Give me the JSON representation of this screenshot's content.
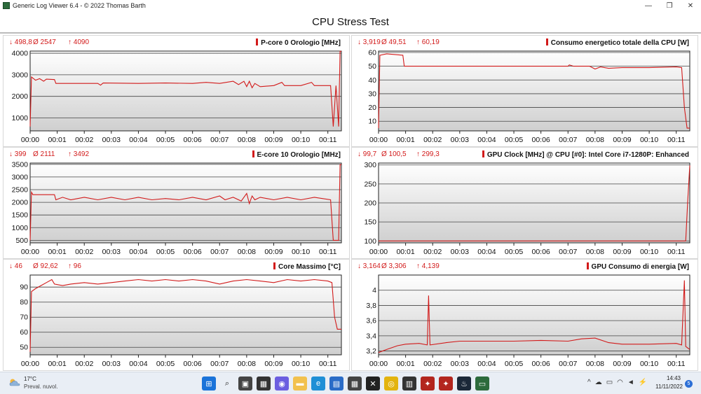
{
  "window": {
    "title": "Generic Log Viewer 6.4 - © 2022 Thomas Barth",
    "minimize_glyph": "—",
    "restore_glyph": "❐",
    "close_glyph": "✕"
  },
  "page_title": "CPU Stress Test",
  "colors": {
    "series": "#d21a1a",
    "grid": "#444444",
    "fill_top": "#ffffff",
    "fill_bottom": "#cfcfcf"
  },
  "panels": [
    {
      "title": "P-core 0 Orologio [MHz]",
      "min": "↓ 498,8",
      "avg": "Ø 2547",
      "max": "↑ 4090",
      "chart_data": {
        "type": "line",
        "ylim": [
          400,
          4100
        ],
        "y_ticks": [
          "4000",
          "3000",
          "2000",
          "1000"
        ],
        "y_tick_values": [
          4000,
          3000,
          2000,
          1000
        ],
        "x_ticks": [
          "00:00",
          "00:01",
          "00:02",
          "00:03",
          "00:04",
          "00:05",
          "00:06",
          "00:07",
          "00:08",
          "00:09",
          "00:10",
          "00:11"
        ],
        "duration_min": 11.5,
        "points": [
          [
            0,
            600
          ],
          [
            0.05,
            2900
          ],
          [
            0.2,
            2750
          ],
          [
            0.35,
            2820
          ],
          [
            0.5,
            2700
          ],
          [
            0.6,
            2800
          ],
          [
            0.9,
            2780
          ],
          [
            0.95,
            2600
          ],
          [
            2.5,
            2600
          ],
          [
            2.6,
            2520
          ],
          [
            2.7,
            2620
          ],
          [
            4,
            2600
          ],
          [
            5,
            2620
          ],
          [
            6,
            2600
          ],
          [
            6.5,
            2650
          ],
          [
            7,
            2600
          ],
          [
            7.5,
            2700
          ],
          [
            7.7,
            2550
          ],
          [
            7.9,
            2700
          ],
          [
            8,
            2450
          ],
          [
            8.1,
            2700
          ],
          [
            8.2,
            2400
          ],
          [
            8.3,
            2600
          ],
          [
            8.5,
            2450
          ],
          [
            9,
            2500
          ],
          [
            9.3,
            2650
          ],
          [
            9.4,
            2500
          ],
          [
            10,
            2500
          ],
          [
            10.4,
            2650
          ],
          [
            10.5,
            2500
          ],
          [
            11.1,
            2500
          ],
          [
            11.2,
            600
          ],
          [
            11.3,
            2500
          ],
          [
            11.4,
            600
          ],
          [
            11.45,
            4090
          ],
          [
            11.5,
            4090
          ]
        ]
      }
    },
    {
      "title": "Consumo energetico totale della CPU [W]",
      "min": "↓ 3,919",
      "avg": "Ø 49,51",
      "max": "↑ 60,19",
      "chart_data": {
        "type": "line",
        "ylim": [
          3,
          61
        ],
        "y_ticks": [
          "60",
          "50",
          "40",
          "30",
          "20",
          "10"
        ],
        "y_tick_values": [
          60,
          50,
          40,
          30,
          20,
          10
        ],
        "x_ticks": [
          "00:00",
          "00:01",
          "00:02",
          "00:03",
          "00:04",
          "00:05",
          "00:06",
          "00:07",
          "00:08",
          "00:09",
          "00:10",
          "00:11"
        ],
        "duration_min": 11.5,
        "points": [
          [
            0,
            5
          ],
          [
            0.05,
            58
          ],
          [
            0.3,
            59
          ],
          [
            0.6,
            58.5
          ],
          [
            0.9,
            58
          ],
          [
            0.95,
            50
          ],
          [
            3,
            50
          ],
          [
            5,
            50
          ],
          [
            7,
            50
          ],
          [
            7.05,
            51
          ],
          [
            7.2,
            50
          ],
          [
            7.8,
            50
          ],
          [
            8,
            48
          ],
          [
            8.2,
            49.5
          ],
          [
            8.5,
            48.5
          ],
          [
            9,
            49
          ],
          [
            10,
            49
          ],
          [
            11,
            49.5
          ],
          [
            11.2,
            49
          ],
          [
            11.3,
            20
          ],
          [
            11.4,
            5
          ],
          [
            11.5,
            5
          ]
        ]
      }
    },
    {
      "title": "E-core 10 Orologio [MHz]",
      "min": "↓ 399",
      "avg": "Ø 2111",
      "max": "↑ 3492",
      "chart_data": {
        "type": "line",
        "ylim": [
          400,
          3550
        ],
        "y_ticks": [
          "3500",
          "3000",
          "2500",
          "2000",
          "1500",
          "1000",
          "500"
        ],
        "y_tick_values": [
          3500,
          3000,
          2500,
          2000,
          1500,
          1000,
          500
        ],
        "x_ticks": [
          "00:00",
          "00:01",
          "00:02",
          "00:03",
          "00:04",
          "00:05",
          "00:06",
          "00:07",
          "00:08",
          "00:09",
          "00:10",
          "00:11"
        ],
        "duration_min": 11.5,
        "points": [
          [
            0,
            500
          ],
          [
            0.05,
            2400
          ],
          [
            0.1,
            2300
          ],
          [
            0.9,
            2300
          ],
          [
            0.95,
            2100
          ],
          [
            1.2,
            2200
          ],
          [
            1.5,
            2100
          ],
          [
            2,
            2200
          ],
          [
            2.5,
            2100
          ],
          [
            3,
            2200
          ],
          [
            3.5,
            2100
          ],
          [
            4,
            2200
          ],
          [
            4.5,
            2100
          ],
          [
            5,
            2150
          ],
          [
            5.5,
            2100
          ],
          [
            6,
            2200
          ],
          [
            6.5,
            2100
          ],
          [
            7,
            2250
          ],
          [
            7.2,
            2100
          ],
          [
            7.5,
            2200
          ],
          [
            7.8,
            2050
          ],
          [
            8,
            2350
          ],
          [
            8.1,
            1950
          ],
          [
            8.2,
            2250
          ],
          [
            8.3,
            2100
          ],
          [
            8.5,
            2200
          ],
          [
            9,
            2100
          ],
          [
            9.5,
            2200
          ],
          [
            10,
            2100
          ],
          [
            10.5,
            2200
          ],
          [
            11.1,
            2100
          ],
          [
            11.2,
            500
          ],
          [
            11.4,
            500
          ],
          [
            11.45,
            3490
          ],
          [
            11.5,
            3490
          ]
        ]
      }
    },
    {
      "title": "GPU Clock [MHz] @ CPU [#0]: Intel Core i7-1280P: Enhanced",
      "min": "↓ 99,7",
      "avg": "Ø 100,5",
      "max": "↑ 299,3",
      "chart_data": {
        "type": "line",
        "ylim": [
          95,
          305
        ],
        "y_ticks": [
          "300",
          "250",
          "200",
          "150",
          "100"
        ],
        "y_tick_values": [
          300,
          250,
          200,
          150,
          100
        ],
        "x_ticks": [
          "00:00",
          "00:01",
          "00:02",
          "00:03",
          "00:04",
          "00:05",
          "00:06",
          "00:07",
          "00:08",
          "00:09",
          "00:10",
          "00:11"
        ],
        "duration_min": 11.5,
        "points": [
          [
            0,
            100
          ],
          [
            5,
            100
          ],
          [
            11.35,
            100
          ],
          [
            11.42,
            200
          ],
          [
            11.5,
            299
          ]
        ]
      }
    },
    {
      "title": "Core Massimo [°C]",
      "min": "↓ 46",
      "avg": "Ø 92,62",
      "max": "↑ 96",
      "chart_data": {
        "type": "line",
        "ylim": [
          45,
          98
        ],
        "y_ticks": [
          "90",
          "80",
          "70",
          "60",
          "50"
        ],
        "y_tick_values": [
          90,
          80,
          70,
          60,
          50
        ],
        "x_ticks": [
          "00:00",
          "00:01",
          "00:02",
          "00:03",
          "00:04",
          "00:05",
          "00:06",
          "00:07",
          "00:08",
          "00:09",
          "00:10",
          "00:11"
        ],
        "duration_min": 11.5,
        "points": [
          [
            0,
            47
          ],
          [
            0.05,
            87
          ],
          [
            0.2,
            89
          ],
          [
            0.4,
            91
          ],
          [
            0.6,
            93
          ],
          [
            0.8,
            95
          ],
          [
            0.9,
            92
          ],
          [
            1.2,
            91
          ],
          [
            1.5,
            92
          ],
          [
            2,
            93
          ],
          [
            2.5,
            92
          ],
          [
            3,
            93
          ],
          [
            3.5,
            94
          ],
          [
            4,
            95
          ],
          [
            4.5,
            94
          ],
          [
            5,
            95
          ],
          [
            5.5,
            94
          ],
          [
            6,
            95
          ],
          [
            6.5,
            94
          ],
          [
            7,
            92
          ],
          [
            7.5,
            94
          ],
          [
            8,
            95
          ],
          [
            8.5,
            94
          ],
          [
            9,
            93
          ],
          [
            9.5,
            95
          ],
          [
            10,
            94
          ],
          [
            10.5,
            95
          ],
          [
            11,
            94
          ],
          [
            11.15,
            93
          ],
          [
            11.25,
            70
          ],
          [
            11.35,
            62
          ],
          [
            11.5,
            62
          ]
        ]
      }
    },
    {
      "title": "GPU Consumo di energia [W]",
      "min": "↓ 3,164",
      "avg": "Ø 3,306",
      "max": "↑ 4,139",
      "chart_data": {
        "type": "line",
        "ylim": [
          3.15,
          4.2
        ],
        "y_ticks": [
          "4",
          "3,8",
          "3,6",
          "3,4",
          "3,2"
        ],
        "y_tick_values": [
          4.0,
          3.8,
          3.6,
          3.4,
          3.2
        ],
        "x_ticks": [
          "00:00",
          "00:01",
          "00:02",
          "00:03",
          "00:04",
          "00:05",
          "00:06",
          "00:07",
          "00:08",
          "00:09",
          "00:10",
          "00:11"
        ],
        "duration_min": 11.5,
        "points": [
          [
            0,
            3.18
          ],
          [
            0.3,
            3.22
          ],
          [
            0.7,
            3.27
          ],
          [
            1,
            3.29
          ],
          [
            1.5,
            3.3
          ],
          [
            1.8,
            3.28
          ],
          [
            1.85,
            3.93
          ],
          [
            1.9,
            3.28
          ],
          [
            2.5,
            3.31
          ],
          [
            3,
            3.33
          ],
          [
            4,
            3.33
          ],
          [
            5,
            3.33
          ],
          [
            6,
            3.34
          ],
          [
            7,
            3.33
          ],
          [
            7.5,
            3.36
          ],
          [
            8,
            3.37
          ],
          [
            8.5,
            3.31
          ],
          [
            9,
            3.29
          ],
          [
            10,
            3.29
          ],
          [
            11,
            3.3
          ],
          [
            11.2,
            3.28
          ],
          [
            11.3,
            4.13
          ],
          [
            11.35,
            3.26
          ],
          [
            11.5,
            3.22
          ]
        ]
      }
    }
  ],
  "taskbar": {
    "weather_temp": "17°C",
    "weather_desc": "Preval. nuvol.",
    "clock_time": "14:43",
    "clock_date": "11/11/2022",
    "notification_count": "5",
    "tray_chevron": "^",
    "icons": [
      "start-icon",
      "search-icon",
      "task-view-icon",
      "widgets-icon",
      "chat-icon",
      "file-explorer-icon",
      "edge-icon",
      "store-icon",
      "calculator-icon",
      "xbox-icon",
      "chrome-icon",
      "hwinfo-icon",
      "app-icon",
      "app-icon",
      "steam-icon",
      "log-viewer-icon"
    ]
  }
}
